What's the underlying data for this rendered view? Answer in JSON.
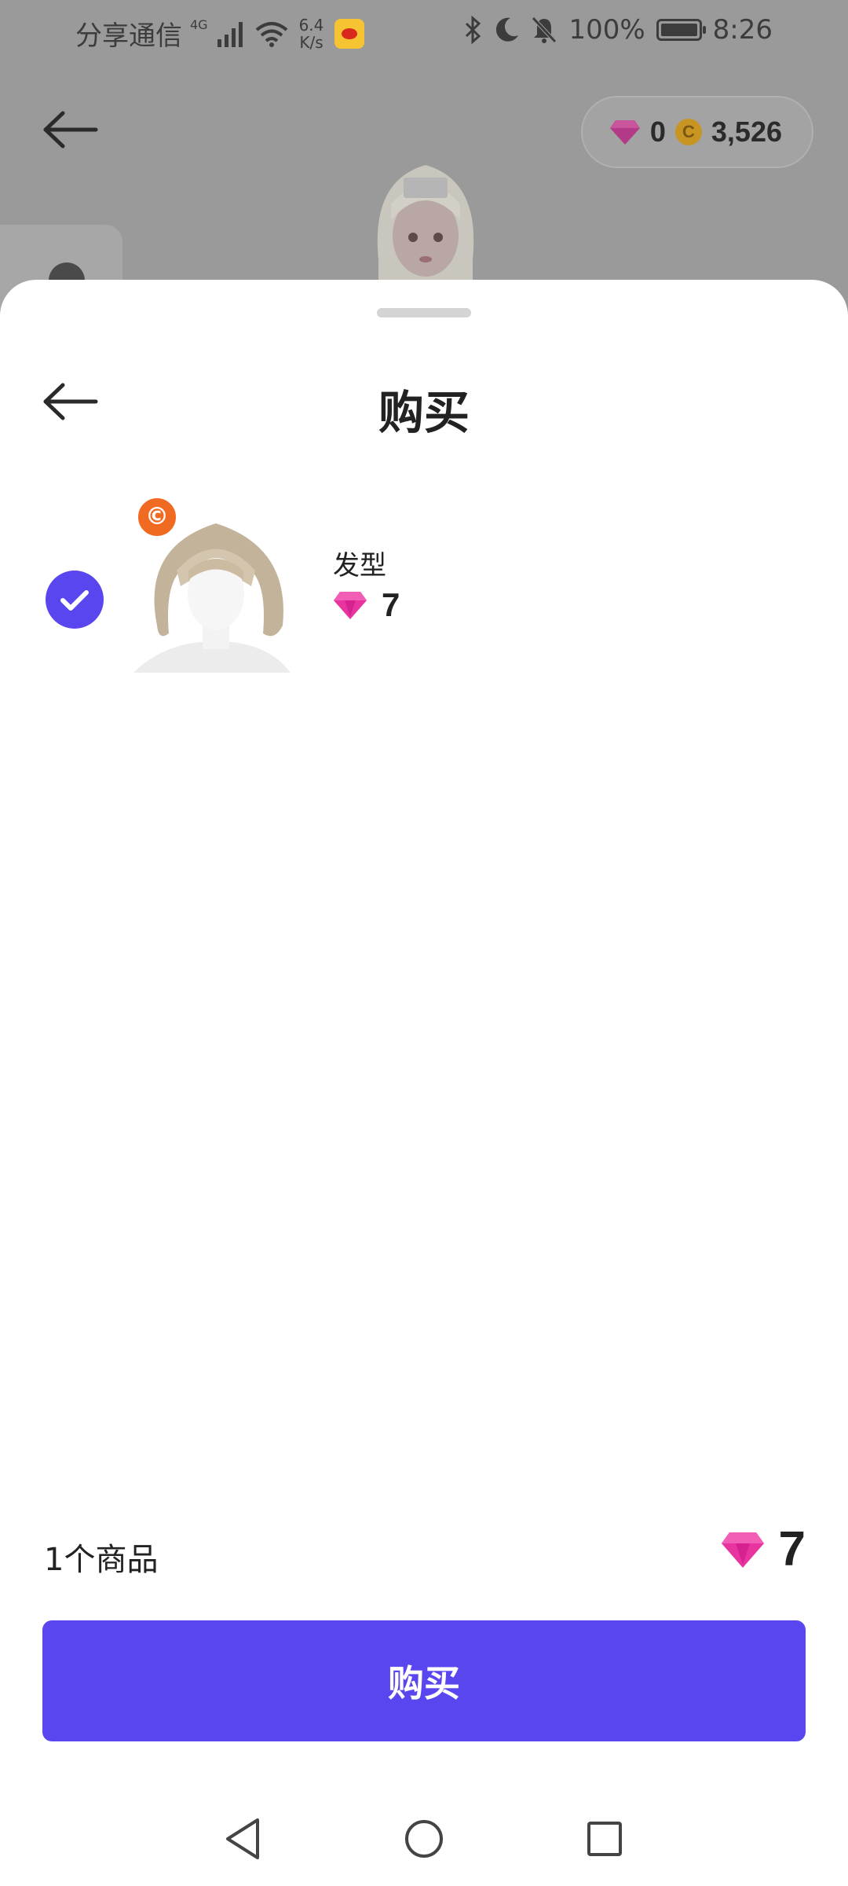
{
  "status_bar": {
    "carrier": "分享通信",
    "network": "4G",
    "speed_value": "6.4",
    "speed_unit": "K/s",
    "battery": "100%",
    "time": "8:26"
  },
  "header": {
    "gems": "0",
    "coins": "3,526"
  },
  "sheet": {
    "title": "购买",
    "items": [
      {
        "name": "发型",
        "price": "7",
        "selected": true,
        "badge": "©"
      }
    ],
    "summary_count": "1个商品",
    "summary_total": "7",
    "buy_label": "购买"
  },
  "colors": {
    "accent": "#5A46EE",
    "gem": "#F040B0",
    "badge": "#F06A22",
    "coin": "#C89422"
  },
  "icons": {
    "back": "back-arrow-icon",
    "gem": "gem-icon",
    "coin": "coin-icon",
    "check": "checkmark-icon",
    "nav": [
      "nav-back-icon",
      "nav-home-icon",
      "nav-recent-icon"
    ]
  }
}
